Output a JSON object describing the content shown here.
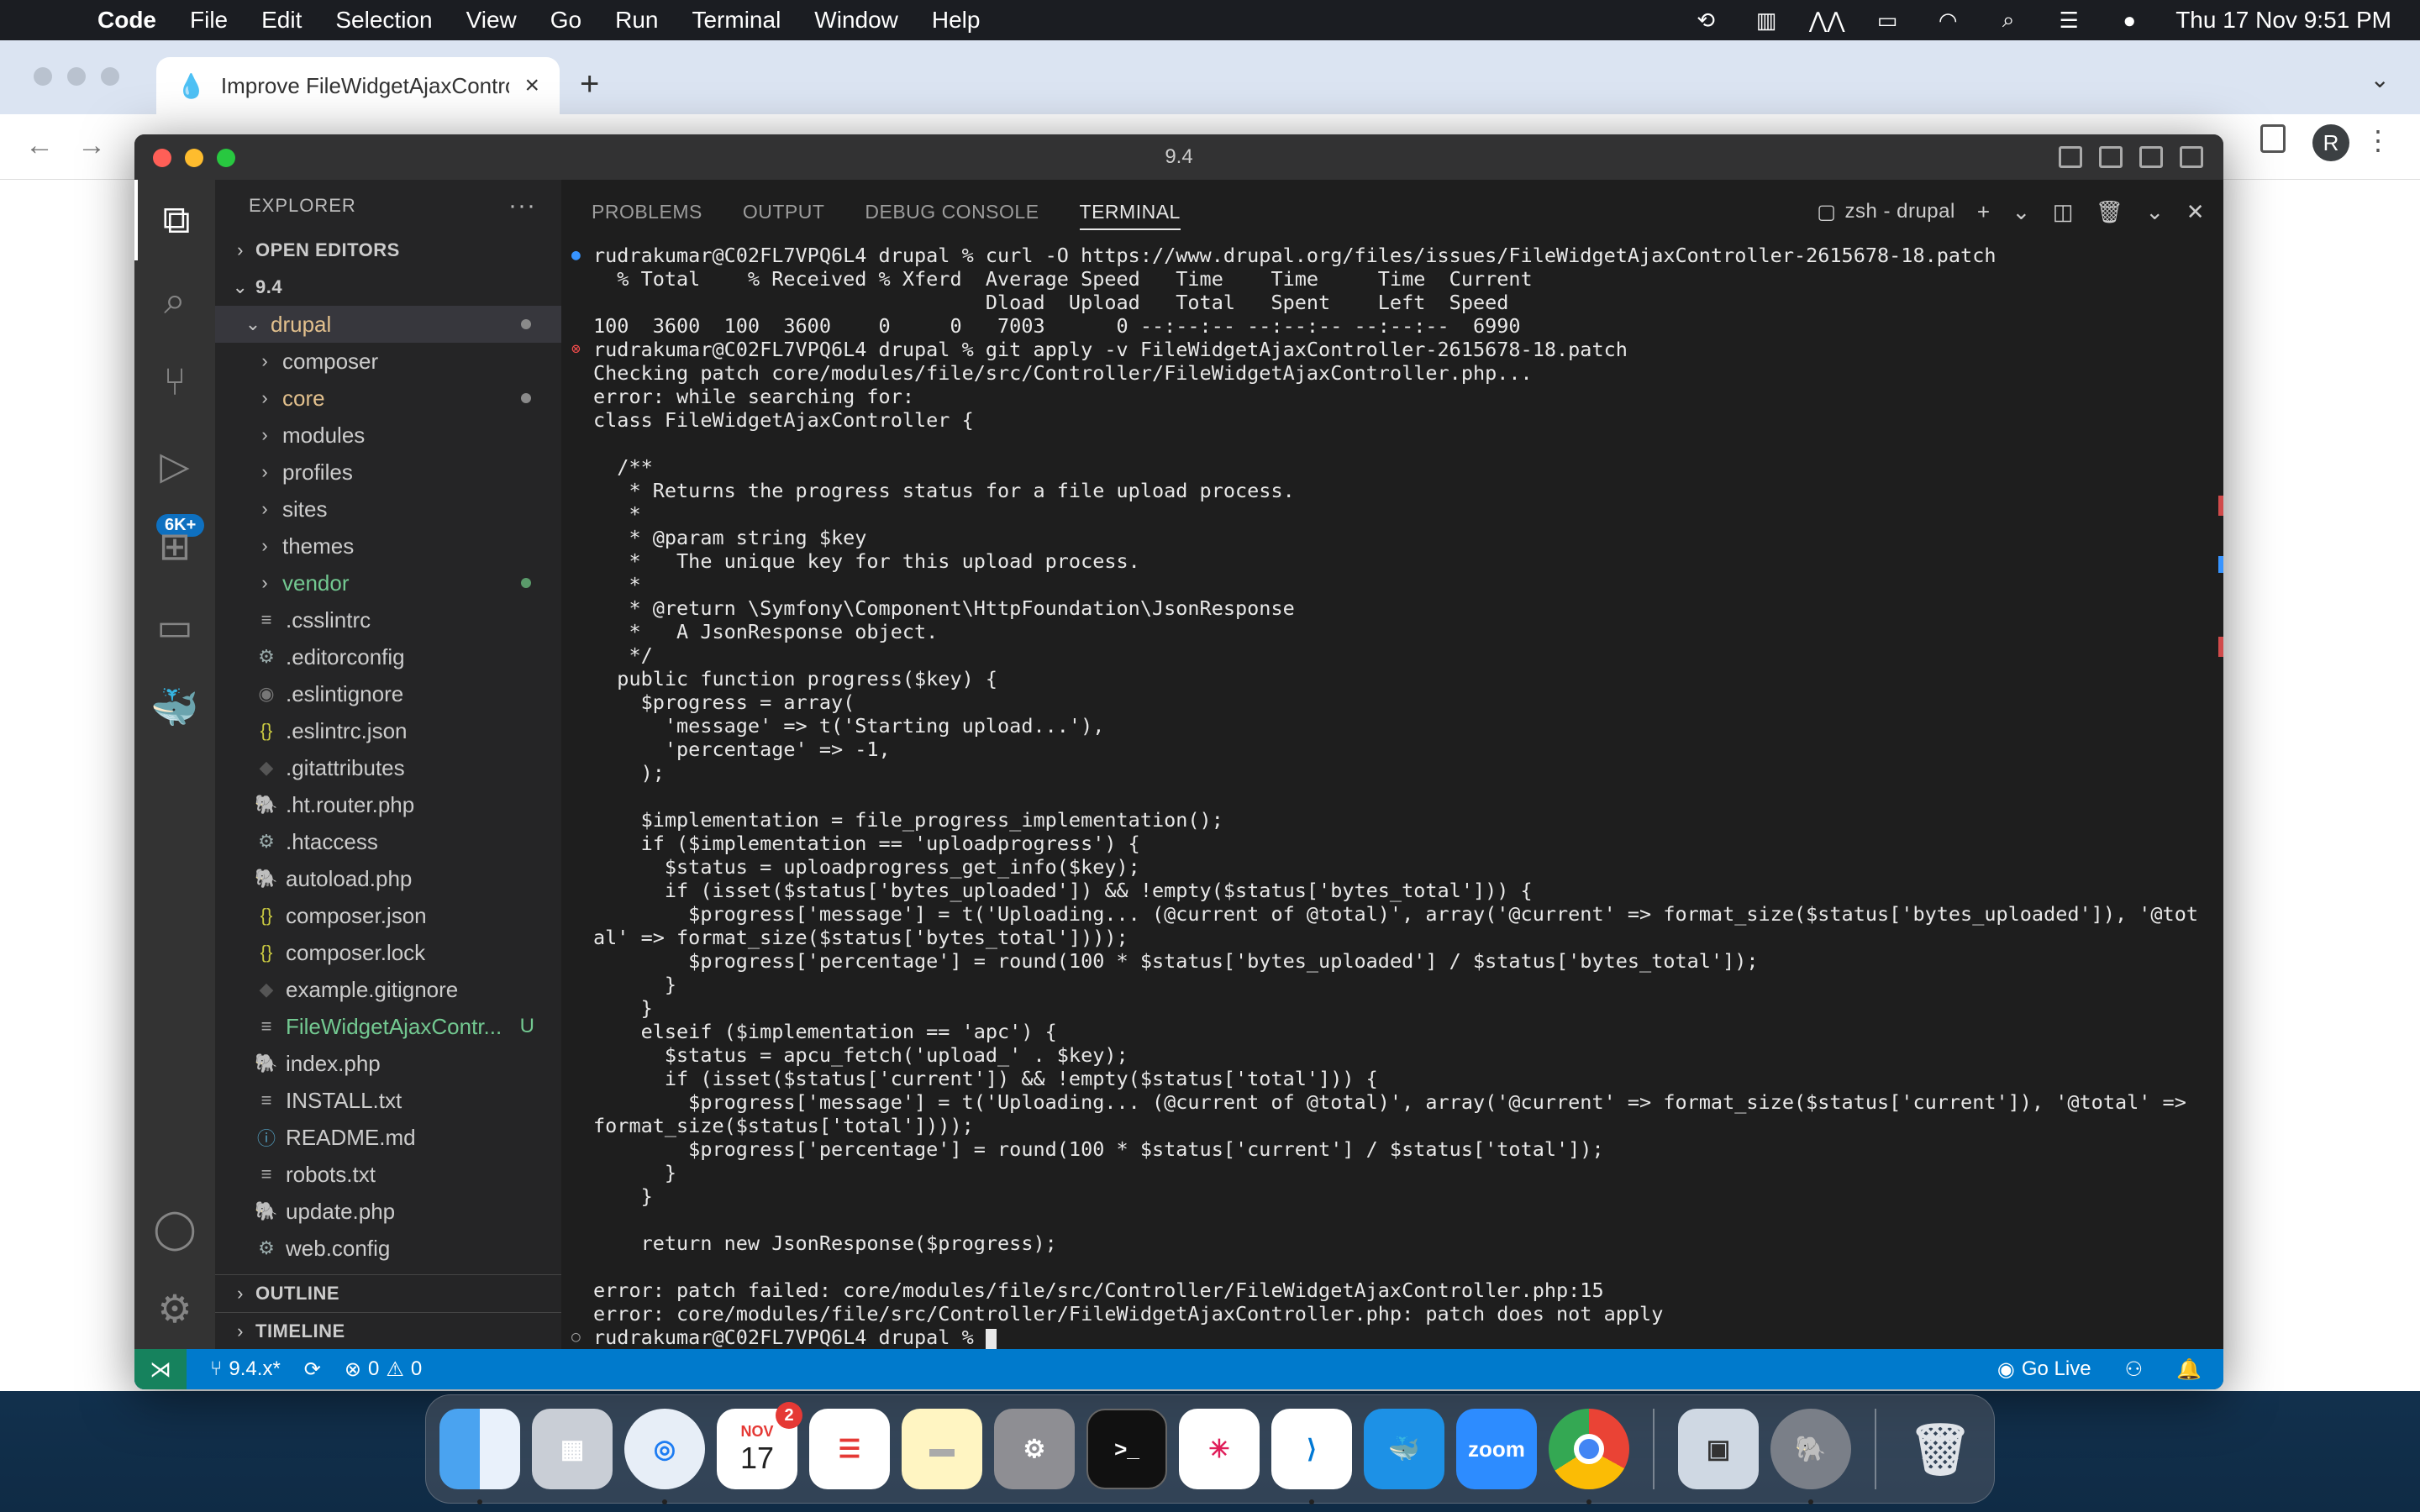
{
  "menubar": {
    "app_name": "Code",
    "items": [
      "File",
      "Edit",
      "Selection",
      "View",
      "Go",
      "Run",
      "Terminal",
      "Window",
      "Help"
    ],
    "clock": "Thu 17 Nov  9:51 PM"
  },
  "browser": {
    "tab_title": "Improve FileWidgetAjaxControl",
    "avatar": "R"
  },
  "window": {
    "title": "9.4"
  },
  "activity": {
    "badge": "6K+"
  },
  "explorer": {
    "header": "EXPLORER",
    "open_editors": "OPEN EDITORS",
    "root": "9.4",
    "folder": "drupal",
    "items": [
      {
        "name": "composer",
        "type": "folder"
      },
      {
        "name": "core",
        "type": "folder",
        "status": "modified"
      },
      {
        "name": "modules",
        "type": "folder"
      },
      {
        "name": "profiles",
        "type": "folder"
      },
      {
        "name": "sites",
        "type": "folder"
      },
      {
        "name": "themes",
        "type": "folder"
      },
      {
        "name": "vendor",
        "type": "folder",
        "status": "untracked"
      },
      {
        "name": ".csslintrc",
        "type": "file"
      },
      {
        "name": ".editorconfig",
        "type": "file"
      },
      {
        "name": ".eslintignore",
        "type": "file"
      },
      {
        "name": ".eslintrc.json",
        "type": "file"
      },
      {
        "name": ".gitattributes",
        "type": "file"
      },
      {
        "name": ".ht.router.php",
        "type": "file"
      },
      {
        "name": ".htaccess",
        "type": "file"
      },
      {
        "name": "autoload.php",
        "type": "file"
      },
      {
        "name": "composer.json",
        "type": "file"
      },
      {
        "name": "composer.lock",
        "type": "file"
      },
      {
        "name": "example.gitignore",
        "type": "file"
      },
      {
        "name": "FileWidgetAjaxContr...",
        "type": "file",
        "status": "untracked",
        "badge": "U"
      },
      {
        "name": "index.php",
        "type": "file"
      },
      {
        "name": "INSTALL.txt",
        "type": "file"
      },
      {
        "name": "README.md",
        "type": "file"
      },
      {
        "name": "robots.txt",
        "type": "file"
      },
      {
        "name": "update.php",
        "type": "file"
      },
      {
        "name": "web.config",
        "type": "file"
      }
    ],
    "outline": "OUTLINE",
    "timeline": "TIMELINE"
  },
  "panel": {
    "tabs": [
      "PROBLEMS",
      "OUTPUT",
      "DEBUG CONSOLE",
      "TERMINAL"
    ],
    "shell": "zsh - drupal"
  },
  "terminal": {
    "lines": [
      "rudrakumar@C02FL7VPQ6L4 drupal % curl -O https://www.drupal.org/files/issues/FileWidgetAjaxController-2615678-18.patch",
      "  % Total    % Received % Xferd  Average Speed   Time    Time     Time  Current",
      "                                 Dload  Upload   Total   Spent    Left  Speed",
      "100  3600  100  3600    0     0   7003      0 --:--:-- --:--:-- --:--:--  6990",
      "rudrakumar@C02FL7VPQ6L4 drupal % git apply -v FileWidgetAjaxController-2615678-18.patch",
      "Checking patch core/modules/file/src/Controller/FileWidgetAjaxController.php...",
      "error: while searching for:",
      "class FileWidgetAjaxController {",
      "",
      "  /**",
      "   * Returns the progress status for a file upload process.",
      "   *",
      "   * @param string $key",
      "   *   The unique key for this upload process.",
      "   *",
      "   * @return \\Symfony\\Component\\HttpFoundation\\JsonResponse",
      "   *   A JsonResponse object.",
      "   */",
      "  public function progress($key) {",
      "    $progress = array(",
      "      'message' => t('Starting upload...'),",
      "      'percentage' => -1,",
      "    );",
      "",
      "    $implementation = file_progress_implementation();",
      "    if ($implementation == 'uploadprogress') {",
      "      $status = uploadprogress_get_info($key);",
      "      if (isset($status['bytes_uploaded']) && !empty($status['bytes_total'])) {",
      "        $progress['message'] = t('Uploading... (@current of @total)', array('@current' => format_size($status['bytes_uploaded']), '@tot",
      "al' => format_size($status['bytes_total'])));",
      "        $progress['percentage'] = round(100 * $status['bytes_uploaded'] / $status['bytes_total']);",
      "      }",
      "    }",
      "    elseif ($implementation == 'apc') {",
      "      $status = apcu_fetch('upload_' . $key);",
      "      if (isset($status['current']) && !empty($status['total'])) {",
      "        $progress['message'] = t('Uploading... (@current of @total)', array('@current' => format_size($status['current']), '@total' =>",
      "format_size($status['total'])));",
      "        $progress['percentage'] = round(100 * $status['current'] / $status['total']);",
      "      }",
      "    }",
      "",
      "    return new JsonResponse($progress);",
      "",
      "error: patch failed: core/modules/file/src/Controller/FileWidgetAjaxController.php:15",
      "error: core/modules/file/src/Controller/FileWidgetAjaxController.php: patch does not apply",
      "rudrakumar@C02FL7VPQ6L4 drupal % "
    ]
  },
  "statusbar": {
    "branch": "9.4.x*",
    "errors": "0",
    "warnings": "0",
    "golive": "Go Live"
  },
  "dock": {
    "calendar_month": "NOV",
    "calendar_day": "17",
    "calendar_badge": "2",
    "zoom_label": "zoom"
  },
  "colors": {
    "statusbar": "#007acc",
    "terminal_bg": "#1e1e1e",
    "modified": "#e2c08d",
    "untracked": "#73c991"
  }
}
